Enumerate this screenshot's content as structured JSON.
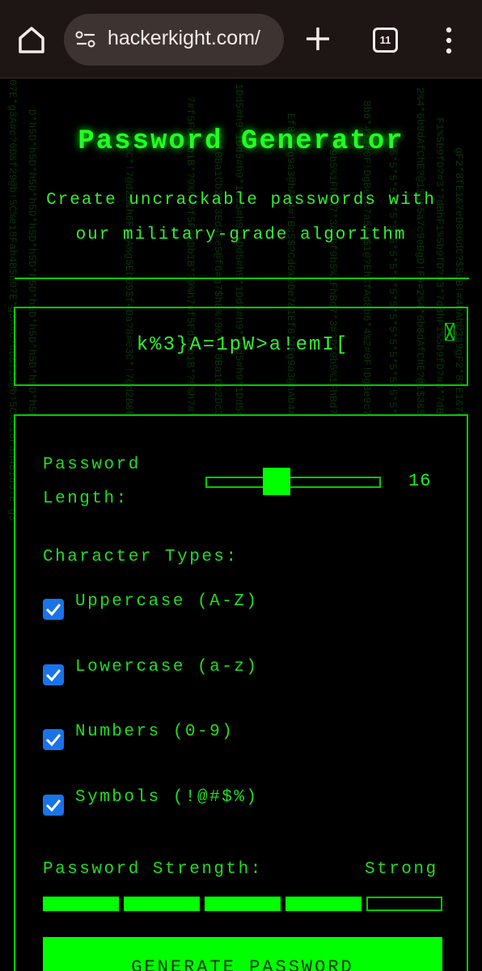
{
  "browser": {
    "url": "hackerkight.com/",
    "tab_count": "11"
  },
  "page": {
    "title": "Password Generator",
    "subtitle_line1": "Create uncrackable passwords with",
    "subtitle_line2": "our military-grade algorithm",
    "password": "k%3}A=1pW>a!emI[",
    "length_label": "Password Length:",
    "length_value": "16",
    "character_types_label": "Character Types:",
    "options": [
      {
        "label": "Uppercase (A-Z)",
        "checked": true
      },
      {
        "label": "Lowercase (a-z)",
        "checked": true
      },
      {
        "label": "Numbers (0-9)",
        "checked": true
      },
      {
        "label": "Symbols (!@#$%)",
        "checked": true
      }
    ],
    "strength_label": "Password Strength:",
    "strength_value": "Strong",
    "strength_level": 4,
    "strength_max": 5,
    "generate_label": "GENERATE PASSWORD"
  },
  "colors": {
    "accent": "#00ff00",
    "checkbox": "#1a73e8",
    "background": "#000000"
  }
}
